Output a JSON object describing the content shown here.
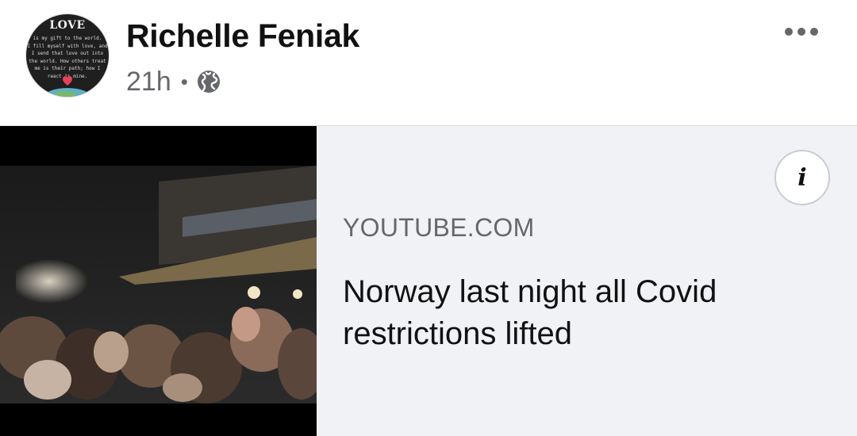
{
  "post": {
    "author": "Richelle Feniak",
    "time": "21h",
    "separator": "•",
    "privacy_icon": "globe-icon",
    "more_icon": "more-options-icon"
  },
  "avatar": {
    "title": "LOVE",
    "lines": [
      "is my gift to the world.",
      "I fill myself with love, and",
      "I send that love out into",
      "the world. How others treat",
      "me is their path; how I",
      "react is mine."
    ]
  },
  "link_preview": {
    "domain": "YOUTUBE.COM",
    "title": "Norway last night all Covid restrictions lifted",
    "info_icon": "info-icon",
    "info_label": "i"
  },
  "colors": {
    "background": "#ffffff",
    "card_background": "#f0f2f5",
    "secondary_text": "#65676b",
    "primary_text": "#111111",
    "divider": "#dadde1"
  }
}
